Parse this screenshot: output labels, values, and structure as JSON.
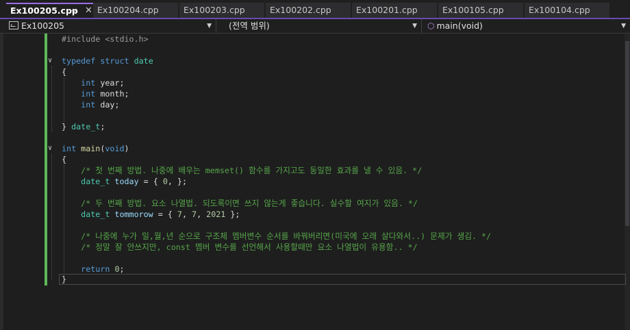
{
  "tabs": [
    {
      "label": "Ex100205.cpp",
      "active": true
    },
    {
      "label": "Ex100204.cpp"
    },
    {
      "label": "Ex100203.cpp"
    },
    {
      "label": "Ex100202.cpp"
    },
    {
      "label": "Ex100201.cpp"
    },
    {
      "label": "Ex100105.cpp"
    },
    {
      "label": "Ex100104.cpp"
    }
  ],
  "tab_icons": {
    "pin": "pin-icon",
    "close": "close-icon"
  },
  "nav": {
    "project": "Ex100205",
    "scope": "(전역 범위)",
    "member": "main(void)"
  },
  "colors": {
    "tab_accent": "#9a6fe0",
    "change_bar": "#5fb85a",
    "keyword": "#569cd6",
    "comment": "#57a64a",
    "type": "#4ec9b0"
  },
  "code": {
    "l1": {
      "a": "#include ",
      "b": "<stdio.h>"
    },
    "l3": {
      "a": "typedef",
      "b": "struct",
      "c": "date"
    },
    "l4": "{",
    "l5": {
      "kw": "int",
      "rest": " year;"
    },
    "l6": {
      "kw": "int",
      "rest": " month;"
    },
    "l7": {
      "kw": "int",
      "rest": " day;"
    },
    "l9": {
      "a": "} ",
      "b": "date_t",
      "c": ";"
    },
    "l11": {
      "kw": "int",
      "fn": "main",
      "p1": "(",
      "kw2": "void",
      "p2": ")"
    },
    "l12": "{",
    "l13": "/* 첫 번째 방법. 나중에 배우는 memset() 함수를 가지고도 동일한 효과를 낼 수 있음. */",
    "l14": {
      "ty": "date_t",
      "v": " today",
      "rest": " = { ",
      "n": "0",
      "end": ", };"
    },
    "l16": "/* 두 번째 방법. 요소 나열법. 되도록이면 쓰지 않는게 좋습니다. 실수할 여지가 있음. */",
    "l17": {
      "ty": "date_t",
      "v": " tommorow",
      "rest": " = { ",
      "n1": "7",
      "s1": ", ",
      "n2": "7",
      "s2": ", ",
      "n3": "2021",
      "end": " };"
    },
    "l19": "/* 나중에 누가 일,월,년 순으로 구조체 멤버변수 순서를 바꿔버리면(미국에 오래 살다와서..) 문제가 생김. */",
    "l20": "/* 정말 잘 안쓰지만, const 멤버 변수를 선언해서 사용할때만 요소 나열법이 유용함.. */",
    "l22": {
      "kw": "return",
      "sp": " ",
      "n": "0",
      "end": ";"
    },
    "l23": "}"
  }
}
